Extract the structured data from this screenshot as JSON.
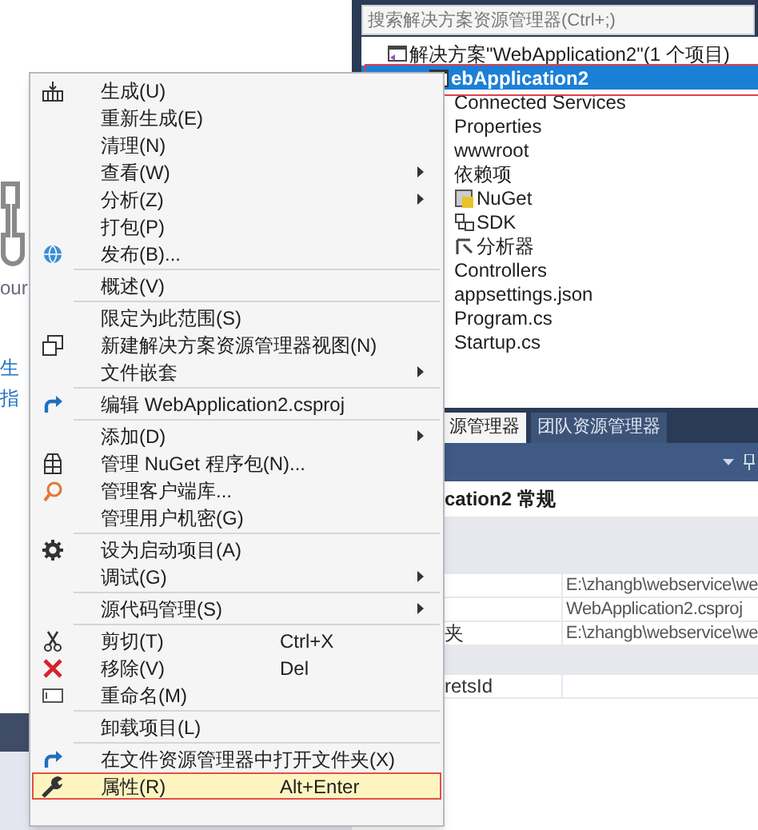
{
  "start_page": {
    "fragments": [
      {
        "kind": "text",
        "text": "our"
      },
      {
        "kind": "link",
        "text": "生"
      },
      {
        "kind": "link",
        "text": "指"
      }
    ]
  },
  "solution_explorer": {
    "search": {
      "placeholder": "搜索解决方案资源管理器(Ctrl+;)"
    },
    "tree": [
      {
        "label": "解决方案\"WebApplication2\"(1 个项目)",
        "selected": false,
        "children": [
          {
            "label": "ebApplication2",
            "selected": true,
            "children": [
              {
                "label": "Connected Services",
                "selected": false
              },
              {
                "label": "Properties",
                "selected": false
              },
              {
                "label": "wwwroot",
                "selected": false
              },
              {
                "label": "依赖项",
                "selected": false,
                "children": [
                  {
                    "label": "NuGet",
                    "selected": false
                  },
                  {
                    "label": "SDK",
                    "selected": false
                  },
                  {
                    "label": "分析器",
                    "selected": false
                  }
                ]
              },
              {
                "label": "Controllers",
                "selected": false
              },
              {
                "label": "appsettings.json",
                "selected": false
              },
              {
                "label": "Program.cs",
                "selected": false
              },
              {
                "label": "Startup.cs",
                "selected": false
              }
            ]
          }
        ]
      }
    ]
  },
  "tabs": [
    {
      "label": "源管理器",
      "selected": true
    },
    {
      "label": "团队资源管理器",
      "selected": false
    }
  ],
  "properties": {
    "title": "cation2 常规",
    "rows": [
      {
        "kind": "category"
      },
      {
        "kind": "category"
      },
      {
        "kind": "property",
        "value": "E:\\zhangb\\webservice\\we"
      },
      {
        "kind": "property",
        "value": "WebApplication2.csproj"
      },
      {
        "kind": "property",
        "label": "夹",
        "value": "E:\\zhangb\\webservice\\we"
      },
      {
        "kind": "category"
      },
      {
        "kind": "property",
        "label": "retsId"
      }
    ]
  },
  "context_menu": {
    "items": [
      {
        "kind": "item",
        "label": "生成(U)",
        "submenu": false,
        "selected": false
      },
      {
        "kind": "item",
        "label": "重新生成(E)",
        "submenu": false,
        "selected": false
      },
      {
        "kind": "item",
        "label": "清理(N)",
        "submenu": false,
        "selected": false
      },
      {
        "kind": "item",
        "label": "查看(W)",
        "submenu": true,
        "selected": false
      },
      {
        "kind": "item",
        "label": "分析(Z)",
        "submenu": true,
        "selected": false
      },
      {
        "kind": "item",
        "label": "打包(P)",
        "submenu": false,
        "selected": false
      },
      {
        "kind": "item",
        "label": "发布(B)...",
        "submenu": false,
        "selected": false
      },
      {
        "kind": "separator"
      },
      {
        "kind": "item",
        "label": "概述(V)",
        "submenu": false,
        "selected": false
      },
      {
        "kind": "separator"
      },
      {
        "kind": "item",
        "label": "限定为此范围(S)",
        "submenu": false,
        "selected": false
      },
      {
        "kind": "item",
        "label": "新建解决方案资源管理器视图(N)",
        "submenu": false,
        "selected": false
      },
      {
        "kind": "item",
        "label": "文件嵌套",
        "submenu": true,
        "selected": false
      },
      {
        "kind": "separator"
      },
      {
        "kind": "item",
        "label": "编辑 WebApplication2.csproj",
        "submenu": false,
        "selected": false
      },
      {
        "kind": "separator"
      },
      {
        "kind": "item",
        "label": "添加(D)",
        "submenu": true,
        "selected": false
      },
      {
        "kind": "item",
        "label": "管理 NuGet 程序包(N)...",
        "submenu": false,
        "selected": false
      },
      {
        "kind": "item",
        "label": "管理客户端库...",
        "submenu": false,
        "selected": false
      },
      {
        "kind": "item",
        "label": "管理用户机密(G)",
        "submenu": false,
        "selected": false
      },
      {
        "kind": "separator"
      },
      {
        "kind": "item",
        "label": "设为启动项目(A)",
        "submenu": false,
        "selected": false
      },
      {
        "kind": "item",
        "label": "调试(G)",
        "submenu": true,
        "selected": false
      },
      {
        "kind": "separator"
      },
      {
        "kind": "item",
        "label": "源代码管理(S)",
        "submenu": true,
        "selected": false
      },
      {
        "kind": "separator"
      },
      {
        "kind": "item",
        "label": "剪切(T)",
        "shortcut": "Ctrl+X",
        "submenu": false,
        "selected": false
      },
      {
        "kind": "item",
        "label": "移除(V)",
        "shortcut": "Del",
        "submenu": false,
        "selected": false
      },
      {
        "kind": "item",
        "label": "重命名(M)",
        "submenu": false,
        "selected": false
      },
      {
        "kind": "separator"
      },
      {
        "kind": "item",
        "label": "卸载项目(L)",
        "submenu": false,
        "selected": false
      },
      {
        "kind": "separator"
      },
      {
        "kind": "item",
        "label": "在文件资源管理器中打开文件夹(X)",
        "submenu": false,
        "selected": false
      },
      {
        "kind": "item",
        "label": "属性(R)",
        "shortcut": "Alt+Enter",
        "submenu": false,
        "selected": true
      }
    ]
  }
}
